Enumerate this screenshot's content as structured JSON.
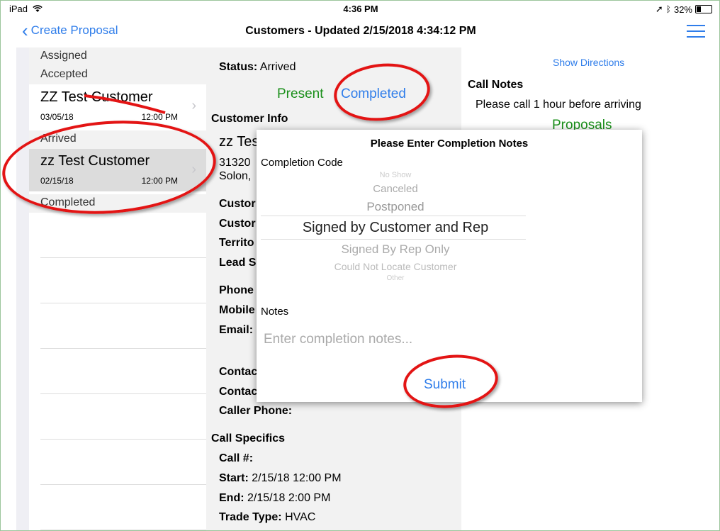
{
  "status_bar": {
    "device": "iPad",
    "time": "4:36 PM",
    "battery": "32%",
    "battery_level": 0.32
  },
  "nav": {
    "back_label": "Create Proposal",
    "title": "Customers - Updated 2/15/2018 4:34:12 PM"
  },
  "list": {
    "assigned_header": "Assigned",
    "accepted_header": "Accepted",
    "accepted_items": [
      {
        "name": "ZZ Test Customer",
        "date": "03/05/18",
        "time": "12:00 PM"
      }
    ],
    "arrived_header": "Arrived",
    "arrived_items": [
      {
        "name": "zz Test Customer",
        "date": "02/15/18",
        "time": "12:00 PM"
      }
    ],
    "completed_header": "Completed"
  },
  "detail": {
    "status_label": "Status:",
    "status_value": "Arrived",
    "present_label": "Present",
    "completed_label": "Completed",
    "customer_info_header": "Customer Info",
    "customer_name": "zz Tes",
    "address_line1": "31320",
    "address_line2": "Solon,",
    "field1": "Custor",
    "field2": "Custor",
    "field3": "Territo",
    "field4": "Lead S",
    "phone_label": "Phone",
    "mobile_label": "Mobile",
    "email_label": "Email:",
    "contact1": "Contac",
    "contact2": "Contac",
    "caller_phone_label": "Caller Phone:",
    "call_specifics_header": "Call Specifics",
    "call_num_label": "Call #:",
    "start_label": "Start:",
    "start_value": "2/15/18 12:00 PM",
    "end_label": "End:",
    "end_value": "2/15/18 2:00 PM",
    "trade_type_label": "Trade Type:",
    "trade_type_value": "HVAC"
  },
  "right": {
    "directions_label": "Show Directions",
    "call_notes_header": "Call Notes",
    "call_notes_text": "Please call 1 hour before arriving",
    "proposals_label": "Proposals"
  },
  "modal": {
    "title": "Please Enter Completion Notes",
    "completion_code_label": "Completion Code",
    "options": [
      "No Show",
      "Canceled",
      "Postponed",
      "Signed by Customer and Rep",
      "Signed By Rep Only",
      "Could Not Locate Customer",
      "Other"
    ],
    "selected_option": "Signed by Customer and Rep",
    "notes_label": "Notes",
    "notes_placeholder": "Enter completion notes...",
    "notes_value": "",
    "submit_label": "Submit"
  },
  "colors": {
    "accent": "#2f7dea",
    "green": "#1a8f1a",
    "annotation": "#e31414"
  }
}
